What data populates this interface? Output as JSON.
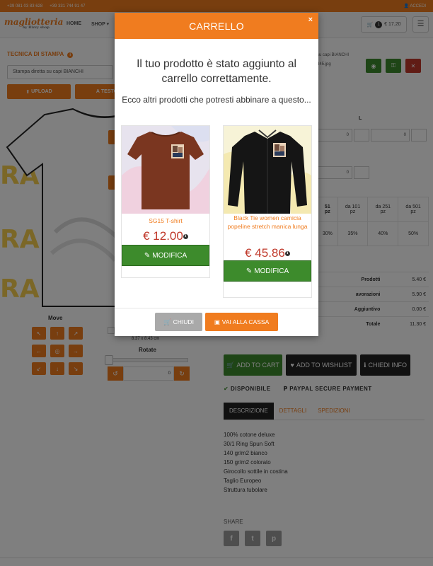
{
  "topbar": {
    "phone1": "+39 081 03 83 628",
    "phone2": "+39 331 744 91 47",
    "login": "ACCEDI"
  },
  "header": {
    "logo": "magliotteria",
    "logo_sub": "by Bizzy shop",
    "nav_home": "HOME",
    "nav_shop": "SHOP",
    "cart_count": "1",
    "cart_total": "€ 17.20",
    "menu_icon": "bars-icon"
  },
  "editor": {
    "print_tech_title": "TECNICA DI STAMPA",
    "print_tech_value": "Stampa diretta su capi BIANCHI",
    "upload_label": "UPLOAD",
    "text_label": "TESTO",
    "move_label": "Move",
    "size_text": "8.37 x 8.43 cm",
    "rotate_label": "Rotate",
    "rotate_value": "0",
    "bg_letters": [
      "RA",
      "RA",
      "RA"
    ]
  },
  "summary": {
    "line1": "su capi BIANCHI",
    "line2": "d45.jpg",
    "col_l": "L",
    "qty_values": [
      "0",
      "0",
      "0"
    ],
    "discounts": [
      {
        "top": "51",
        "unit": "pz",
        "pct": "30%"
      },
      {
        "top": "da 101",
        "unit": "pz",
        "pct": "35%"
      },
      {
        "top": "da 251",
        "unit": "pz",
        "pct": "40%"
      },
      {
        "top": "da 501",
        "unit": "pz",
        "pct": "50%"
      }
    ],
    "prices": [
      {
        "label": "Prodotti",
        "value": "5.40 €"
      },
      {
        "label": "avorazioni",
        "value": "5.90 €"
      },
      {
        "label": "Aggiuntivo",
        "value": "0.00 €"
      },
      {
        "label": "Totale",
        "value": "11.30 €"
      }
    ]
  },
  "actions": {
    "add_to_cart": "ADD TO CART",
    "add_to_wishlist": "ADD TO WISHLIST",
    "ask_info": "CHIEDI INFO",
    "available": "DISPONIBILE",
    "paypal": "PAYPAL SECURE PAYMENT"
  },
  "tabs": [
    "DESCRIZIONE",
    "DETTAGLI",
    "SPEDIZIONI"
  ],
  "description": [
    "100% cotone deluxe",
    "30/1 Ring Spun Soft",
    "140 gr/m2 bianco",
    "150 gr/m2 colorato",
    "Girocollo sottile in costina",
    "Taglio Europeo",
    "Struttura tubolare"
  ],
  "share": {
    "label": "SHARE",
    "icons": [
      "facebook-icon",
      "twitter-icon",
      "pinterest-icon"
    ]
  },
  "modal": {
    "title": "CARRELLO",
    "close": "×",
    "message": "Il tuo prodotto è stato aggiunto al carrello correttamente.",
    "suggest": "Ecco altri prodotti che potresti abbinare a questo...",
    "products": [
      {
        "name": "SG15 T-shirt",
        "price": "€ 12.00",
        "button": "MODIFICA",
        "color": "#7a3620"
      },
      {
        "name": "Black Tie women camicia popeline stretch manica lunga",
        "price": "€ 45.86",
        "button": "MODIFICA",
        "color": "#151515"
      }
    ],
    "close_button": "CHIUDI",
    "checkout_button": "VAI ALLA CASSA"
  },
  "colors": {
    "accent": "#f07c1f",
    "green": "#3d8b2c",
    "price_red": "#c0392b"
  }
}
